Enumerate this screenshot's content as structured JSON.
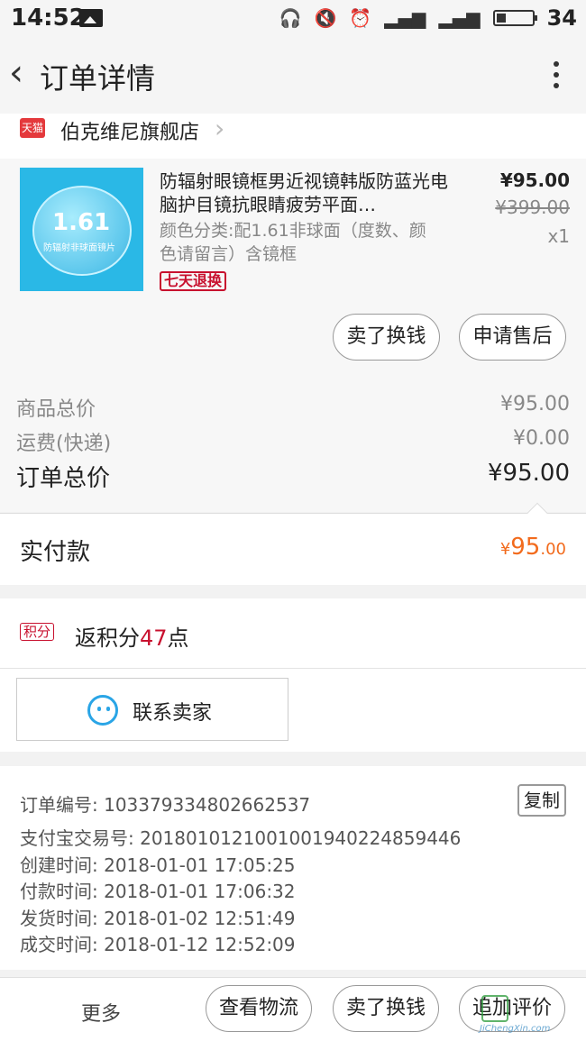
{
  "status_bar": {
    "time": "14:52",
    "battery_level": "34",
    "icons": [
      "image-icon",
      "headset-icon",
      "mute-icon",
      "alarm-icon",
      "signal-icon",
      "4g-signal-icon",
      "battery-icon"
    ]
  },
  "nav": {
    "title": "订单详情",
    "back_icon": "chevron-left-icon",
    "more_icon": "more-vertical-icon"
  },
  "store": {
    "badge": "天猫",
    "name": "伯克维尼旗舰店"
  },
  "product": {
    "title": "防辐射眼镜框男近视镜韩版防蓝光电脑护目镜抗眼睛疲劳平面…",
    "sku": "颜色分类:配1.61非球面（度数、颜色请留言）含镜框",
    "tag": "七天退换",
    "price": "¥95.00",
    "original_price": "¥399.00",
    "quantity": "x1",
    "thumb_number": "1.61",
    "thumb_label": "防辐射非球面镜片",
    "actions": [
      "卖了换钱",
      "申请售后"
    ]
  },
  "summary": {
    "goods_total_label": "商品总价",
    "goods_total": "¥95.00",
    "shipping_label": "运费(快递)",
    "shipping": "¥0.00",
    "order_total_label": "订单总价",
    "order_total": "¥95.00"
  },
  "paid": {
    "label": "实付款",
    "currency": "¥",
    "amount_int": "95",
    "amount_dec": ".00"
  },
  "points": {
    "badge": "积分",
    "prefix": "返积分",
    "value": "47",
    "suffix": "点"
  },
  "contact": {
    "label": "联系卖家"
  },
  "order_info": {
    "order_no": "订单编号: 103379334802662537",
    "copy_label": "复制",
    "alipay_no": "支付宝交易号: 2018010121001001940224859446",
    "created": "创建时间: 2018-01-01 17:05:25",
    "paid": "付款时间: 2018-01-01 17:06:32",
    "shipped": "发货时间: 2018-01-02 12:51:49",
    "completed": "成交时间: 2018-01-12 12:52:09"
  },
  "bottom_bar": {
    "more": "更多",
    "buttons": [
      "查看物流",
      "卖了换钱",
      "追加评价"
    ]
  },
  "watermark": {
    "text": "JiChengXin.com"
  }
}
